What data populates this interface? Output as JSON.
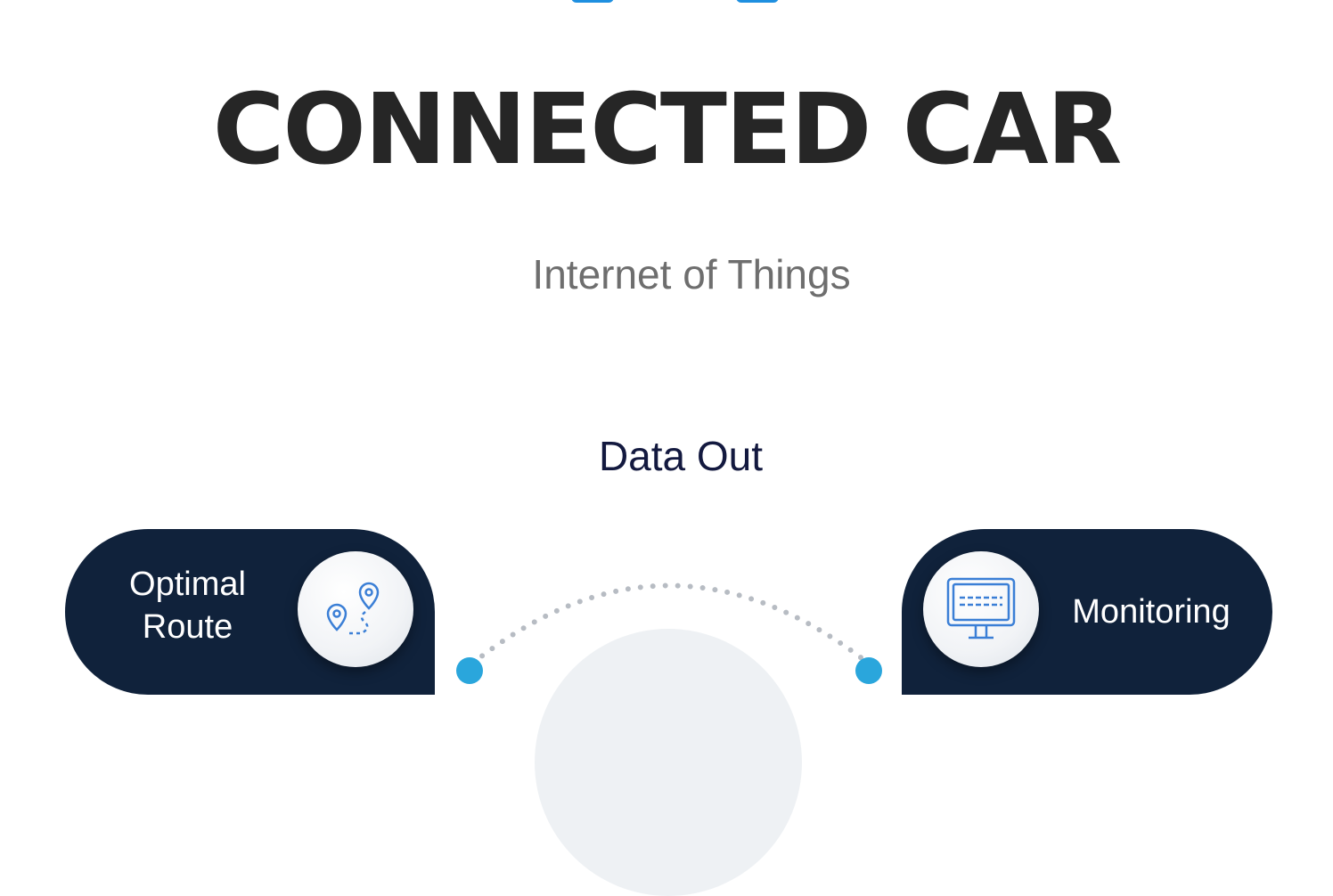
{
  "header": {
    "title": "CONNECTED CAR",
    "subtitle": "Internet of Things"
  },
  "section": {
    "label": "Data Out"
  },
  "diagram": {
    "left_pill": {
      "label_line1": "Optimal",
      "label_line2": "Route",
      "icon": "route-pins-icon"
    },
    "right_pill": {
      "label": "Monitoring",
      "icon": "monitor-icon"
    }
  },
  "colors": {
    "title": "#262626",
    "subtitle": "#6e6e6e",
    "section_label": "#13193f",
    "pill_bg": "#10223b",
    "accent": "#2aa6dc",
    "icon_stroke": "#3b7fd6"
  }
}
